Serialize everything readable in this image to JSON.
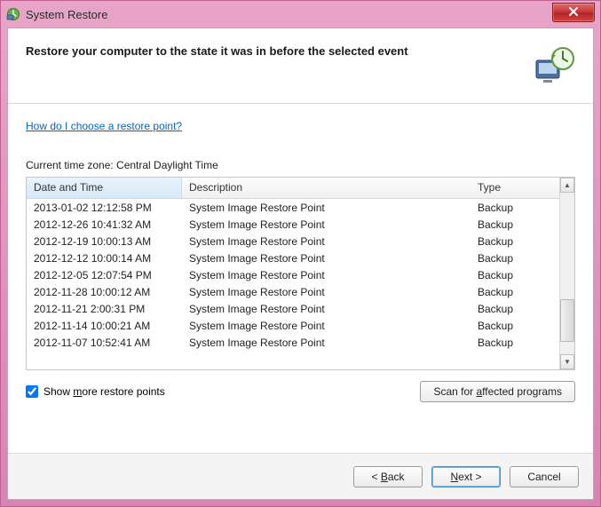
{
  "titlebar": {
    "title": "System Restore"
  },
  "header": {
    "instruction": "Restore your computer to the state it was in before the selected event"
  },
  "content": {
    "help_link": "How do I choose a restore point?",
    "timezone_label": "Current time zone: Central Daylight Time",
    "columns": {
      "datetime": "Date and Time",
      "description": "Description",
      "type": "Type"
    },
    "rows": [
      {
        "dt": "2013-01-02 12:12:58 PM",
        "desc": "System Image Restore Point",
        "type": "Backup"
      },
      {
        "dt": "2012-12-26 10:41:32 AM",
        "desc": "System Image Restore Point",
        "type": "Backup"
      },
      {
        "dt": "2012-12-19 10:00:13 AM",
        "desc": "System Image Restore Point",
        "type": "Backup"
      },
      {
        "dt": "2012-12-12 10:00:14 AM",
        "desc": "System Image Restore Point",
        "type": "Backup"
      },
      {
        "dt": "2012-12-05 12:07:54 PM",
        "desc": "System Image Restore Point",
        "type": "Backup"
      },
      {
        "dt": "2012-11-28 10:00:12 AM",
        "desc": "System Image Restore Point",
        "type": "Backup"
      },
      {
        "dt": "2012-11-21 2:00:31 PM",
        "desc": "System Image Restore Point",
        "type": "Backup"
      },
      {
        "dt": "2012-11-14 10:00:21 AM",
        "desc": "System Image Restore Point",
        "type": "Backup"
      },
      {
        "dt": "2012-11-07 10:52:41 AM",
        "desc": "System Image Restore Point",
        "type": "Backup"
      }
    ],
    "show_more_label": "Show more restore points",
    "show_more_checked": true,
    "scan_button": "Scan for affected programs"
  },
  "footer": {
    "back": "< Back",
    "next": "Next >",
    "cancel": "Cancel"
  }
}
